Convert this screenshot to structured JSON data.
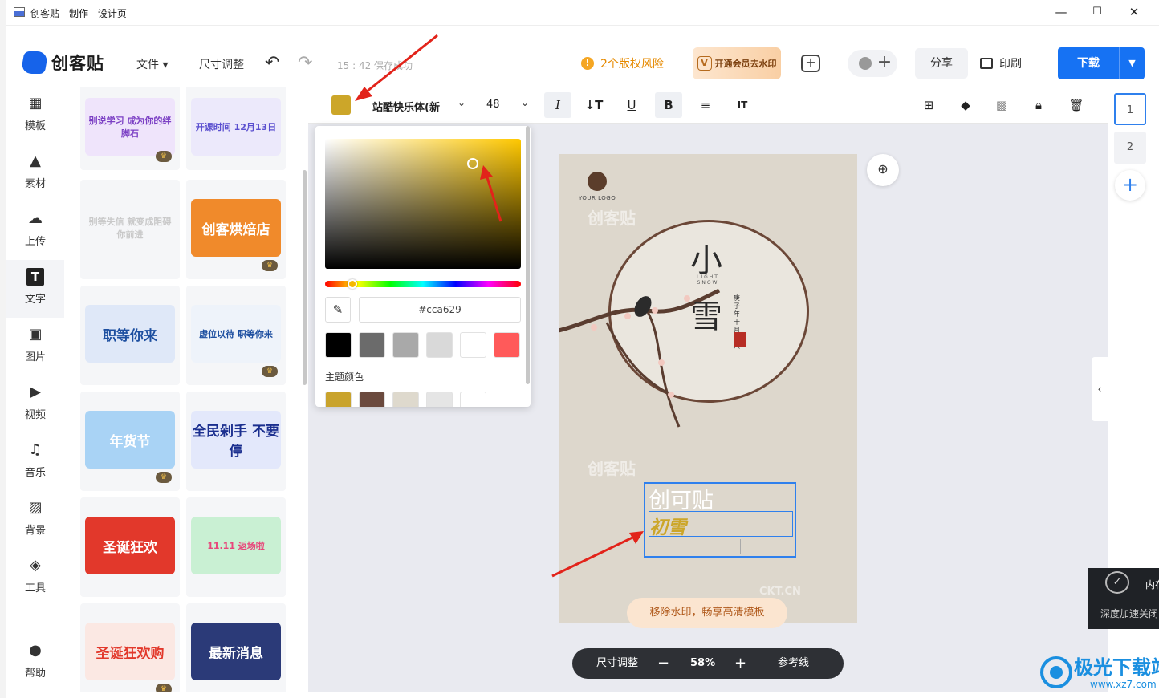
{
  "window": {
    "title": "创客贴 - 制作 - 设计页",
    "minimize": "—",
    "maximize": "☐",
    "close": "✕"
  },
  "header": {
    "logo_text": "创客贴",
    "menu_file": "文件 ▾",
    "menu_resize": "尺寸调整",
    "save_status": "15 : 42 保存成功",
    "copyright_risk": "2个版权风险",
    "vip_button": "开通会员去水印",
    "share": "分享",
    "print": "印刷",
    "download": "下载"
  },
  "nav": [
    {
      "label": "模板",
      "icon": "template-icon"
    },
    {
      "label": "素材",
      "icon": "shape-icon"
    },
    {
      "label": "上传",
      "icon": "upload-icon"
    },
    {
      "label": "文字",
      "icon": "text-icon"
    },
    {
      "label": "图片",
      "icon": "image-icon"
    },
    {
      "label": "视频",
      "icon": "video-icon"
    },
    {
      "label": "音乐",
      "icon": "music-icon"
    },
    {
      "label": "背景",
      "icon": "background-icon"
    },
    {
      "label": "工具",
      "icon": "tools-icon"
    },
    {
      "label": "帮助",
      "icon": "help-icon"
    }
  ],
  "templates": [
    {
      "text": "别说学习 成为你的绊脚石",
      "color": "#7b3fc4",
      "bg": "#efe4fb",
      "vip": true
    },
    {
      "text": "开课时间 12月13日",
      "color": "#5a4fcf",
      "bg": "#ece9fb",
      "vip": false
    },
    {
      "text": "别等失信 就变成阻碍你前进",
      "color": "#c9c9c9",
      "bg": "#f5f6f8",
      "vip": false
    },
    {
      "text": "创客烘焙店",
      "color": "#ffffff",
      "bg": "#f08a2b",
      "vip": true
    },
    {
      "text": "职等你来",
      "color": "#1d4fa0",
      "bg": "#dfe8f8",
      "vip": false
    },
    {
      "text": "虚位以待 职等你来",
      "color": "#1d4fa0",
      "bg": "#eef3fa",
      "vip": true
    },
    {
      "text": "年货节",
      "color": "#ffffff",
      "bg": "#a9d3f5",
      "vip": true
    },
    {
      "text": "全民剁手 不要停",
      "color": "#1b2f8f",
      "bg": "#e3e8fb",
      "vip": false
    },
    {
      "text": "圣诞狂欢",
      "color": "#ffffff",
      "bg": "#e2382b",
      "vip": false
    },
    {
      "text": "11.11 返场啦",
      "color": "#e8457a",
      "bg": "#c9f0d3",
      "vip": false
    },
    {
      "text": "圣诞狂欢购",
      "color": "#e2382b",
      "bg": "#fbe8e3",
      "vip": true
    },
    {
      "text": "最新消息",
      "color": "#ffffff",
      "bg": "#2b3a78",
      "vip": false
    }
  ],
  "text_toolbar": {
    "color": "#cca629",
    "font_name": "站酷快乐体(新",
    "font_size": "48",
    "italic": "I",
    "line_height": "↓T",
    "underline": "U",
    "bold": "B",
    "align": "≡",
    "spacing": "IT"
  },
  "color_picker": {
    "hex_value": "#cca629",
    "presets": [
      "#000000",
      "#6b6b6b",
      "#a9a9a9",
      "#d9d9d9",
      "#ffffff",
      "#ff5a5a"
    ],
    "theme_label": "主题颜色",
    "theme_colors": [
      "#c9a32c",
      "#6b4a3e",
      "#ded9cd",
      "#e5e5e5",
      "#ffffff"
    ]
  },
  "design": {
    "logo_text": "YOUR LOGO",
    "watermark": "创客贴",
    "watermark_url": "CKT.CN",
    "title_char_1": "小",
    "title_char_2": "雪",
    "subtitle": "LIGHT SNOW",
    "date_vertical": "庚子年 十月初八",
    "text_1": "创可贴",
    "text_2": "初雪"
  },
  "canvas": {
    "remove_watermark": "移除水印，畅享高清模板",
    "zoom_resize": "尺寸调整",
    "zoom_minus": "−",
    "zoom_level": "58%",
    "zoom_plus": "+",
    "guides": "参考线"
  },
  "pages": [
    "1",
    "2"
  ],
  "overlay": {
    "accel_title": "内存",
    "accel_sub": "深度加速关闭",
    "brand_name": "极光下载站",
    "brand_url": "www.xz7.com"
  }
}
